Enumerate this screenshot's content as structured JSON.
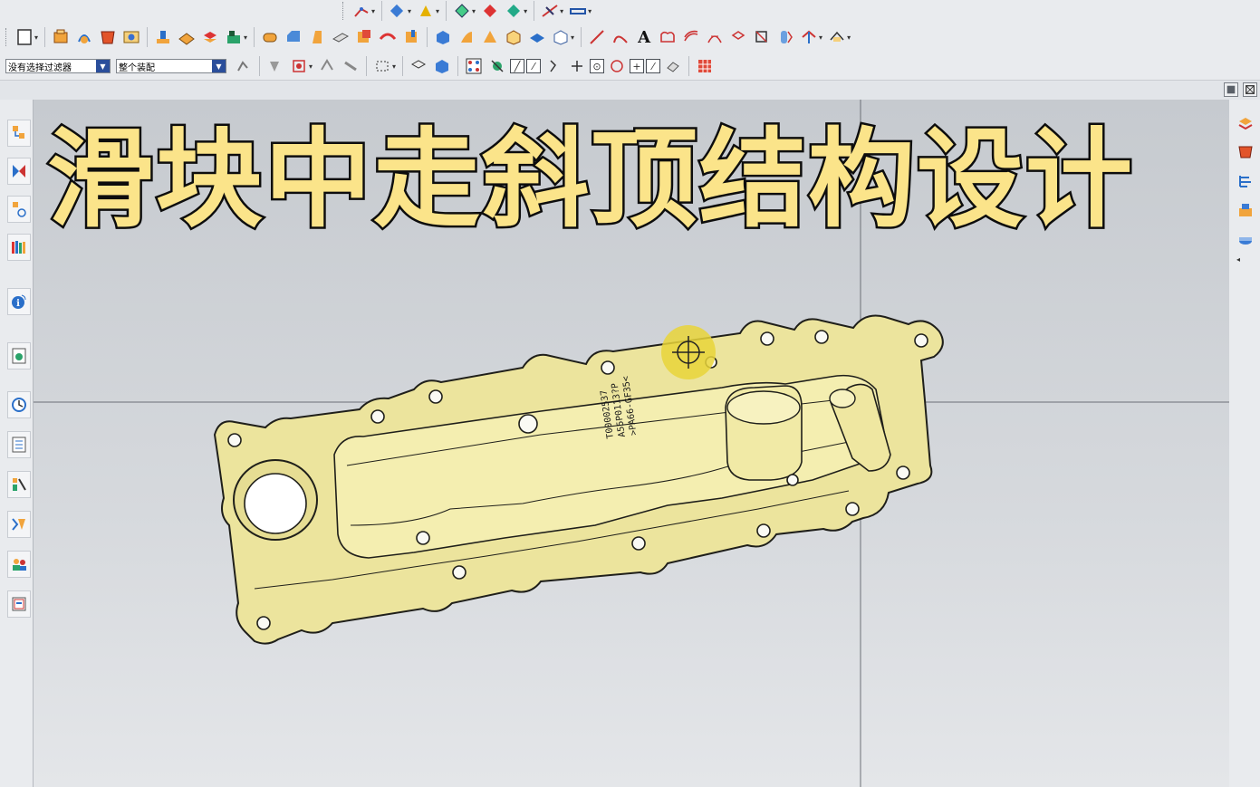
{
  "filters": {
    "selection_filter": "没有选择过滤器",
    "scope": "整个装配"
  },
  "overlay": {
    "title": "滑块中走斜顶结构设计"
  },
  "part": {
    "label_line1": "T00002537",
    "label_line2": "A55P0113?P",
    "label_line3": ">PA66-GF35<"
  },
  "toolbar": {
    "text_tool_glyph": "A"
  },
  "colors": {
    "part_fill": "#f2eca8",
    "part_edge": "#1f1f1a",
    "title_fill": "#fbe48a",
    "viewport_bg": "#cfd3d8",
    "cursor_highlight": "#e9d53a"
  },
  "icons": {
    "left_dock": [
      "assembly-navigator-icon",
      "constraint-navigator-icon",
      "part-navigator-icon",
      "reuse-library-icon",
      "info-icon",
      "web-browser-icon",
      "history-icon",
      "system-materials-icon",
      "process-studio-icon",
      "roles-icon",
      "visualization-icon",
      "palette-icon"
    ],
    "right_dock": [
      "mold-wizard-icon",
      "part-family-icon",
      "tool-palette-icon",
      "mold-tools-icon",
      "electrode-icon"
    ]
  }
}
